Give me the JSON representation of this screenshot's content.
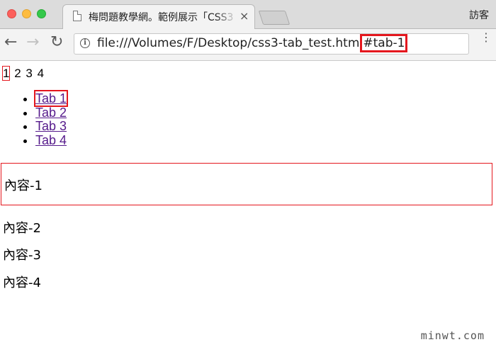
{
  "browser": {
    "tab_title": "梅問題教學網。範例展示「CSS3",
    "tab_close_glyph": "×",
    "profile_name": "訪客",
    "url_base": "file:///Volumes/F/Desktop/css3-tab_test.htm",
    "url_hash": "#tab-1",
    "info_glyph": "i",
    "back_glyph": "←",
    "forward_glyph": "→",
    "reload_glyph": "↻",
    "menu_glyph": "⋮"
  },
  "page": {
    "anchors": [
      "1",
      "2",
      "3",
      "4"
    ],
    "tabs": [
      "Tab 1",
      "Tab 2",
      "Tab 3",
      "Tab 4"
    ],
    "panels": [
      "內容-1",
      "內容-2",
      "內容-3",
      "內容-4"
    ]
  },
  "watermark": "minwt.com"
}
